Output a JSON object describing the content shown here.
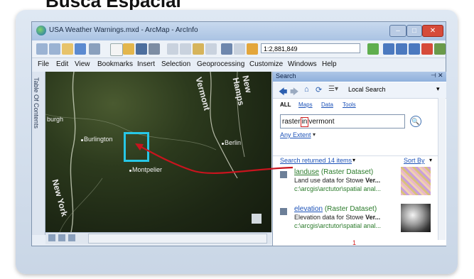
{
  "heading": "Busca Espacial",
  "window": {
    "title": "USA Weather Warnings.mxd - ArcMap - ArcInfo",
    "scale_value": "1:2,881,849",
    "minimize_icon": "minimize-icon",
    "maximize_icon": "maximize-icon",
    "close_icon": "close-icon"
  },
  "menu": [
    "File",
    "Edit",
    "View",
    "Bookmarks",
    "Insert",
    "Selection",
    "Geoprocessing",
    "Customize",
    "Windows",
    "Help"
  ],
  "toc_label": "Table Of Contents",
  "map": {
    "labels": {
      "burlington": "Burlington",
      "montpelier": "Montpelier",
      "berlin": "Berlin",
      "burgh": "burgh"
    },
    "states": {
      "vermont": "Vermont",
      "new_hampshire": "New Hamps",
      "new_york": "New York"
    },
    "highlight_color": "#27c7e6"
  },
  "search": {
    "panel_title": "Search",
    "scope": "Local Search",
    "tabs": [
      "ALL",
      "Maps",
      "Data",
      "Tools"
    ],
    "query_prefix": "raster",
    "query_cursor": "in",
    "query_suffix": "vermont",
    "extent": "Any Extent",
    "results_summary": "Search returned 14 items",
    "sort_label": "Sort By",
    "results": [
      {
        "name": "landuse",
        "type": "(Raster Dataset)",
        "desc_prefix": "Land use data for Stowe ",
        "desc_bold": "Ver...",
        "path": "c:\\arcgis\\arctutor\\spatial anal..."
      },
      {
        "name": "elevation",
        "type": "(Raster Dataset)",
        "desc_prefix": "Elevation data for Stowe ",
        "desc_bold": "Ver...",
        "path": "c:\\arcgis\\arctutor\\spatial anal..."
      }
    ],
    "page_number": "1",
    "page_color": "#d32020"
  },
  "colors": {
    "annotation_arrow": "#c8141e",
    "link": "#1c52b8",
    "path_green": "#2a7a2a"
  }
}
